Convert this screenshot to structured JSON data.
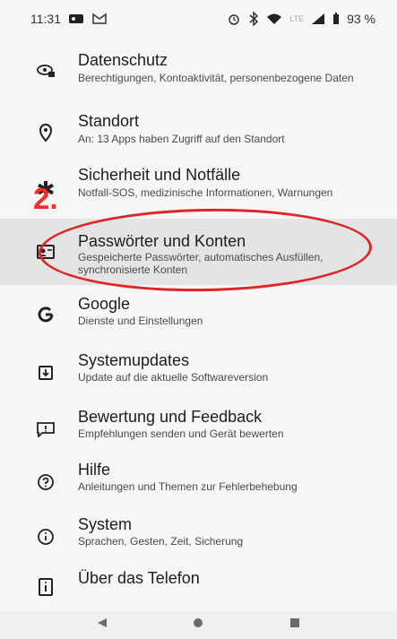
{
  "status": {
    "time": "11:31",
    "battery": "93 %",
    "network": "LTE"
  },
  "items": [
    {
      "title": "Datenschutz",
      "subtitle": "Berechtigungen, Kontoaktivität, personenbezogene Daten",
      "icon": "eye-lock-icon"
    },
    {
      "title": "Standort",
      "subtitle": "An: 13 Apps haben Zugriff auf den Standort",
      "icon": "location-pin-icon"
    },
    {
      "title": "Sicherheit und Notfälle",
      "subtitle": "Notfall-SOS, medizinische Informationen, Warnungen",
      "icon": "medical-star-icon"
    },
    {
      "title": "Passwörter und Konten",
      "subtitle": "Gespeicherte Passwörter, automatisches Ausfüllen, synchronisierte Konten",
      "icon": "account-card-icon"
    },
    {
      "title": "Google",
      "subtitle": "Dienste und Einstellungen",
      "icon": "google-icon"
    },
    {
      "title": "Systemupdates",
      "subtitle": "Update auf die aktuelle Softwareversion",
      "icon": "system-update-icon"
    },
    {
      "title": "Bewertung und Feedback",
      "subtitle": "Empfehlungen senden und Gerät bewerten",
      "icon": "feedback-icon"
    },
    {
      "title": "Hilfe",
      "subtitle": "Anleitungen und Themen zur Fehlerbehebung",
      "icon": "help-icon"
    },
    {
      "title": "System",
      "subtitle": "Sprachen, Gesten, Zeit, Sicherung",
      "icon": "info-icon"
    },
    {
      "title": "Über das Telefon",
      "subtitle": "",
      "icon": "phone-info-icon"
    }
  ],
  "annotation": {
    "number": "2.",
    "color": "#ff2a2a"
  }
}
